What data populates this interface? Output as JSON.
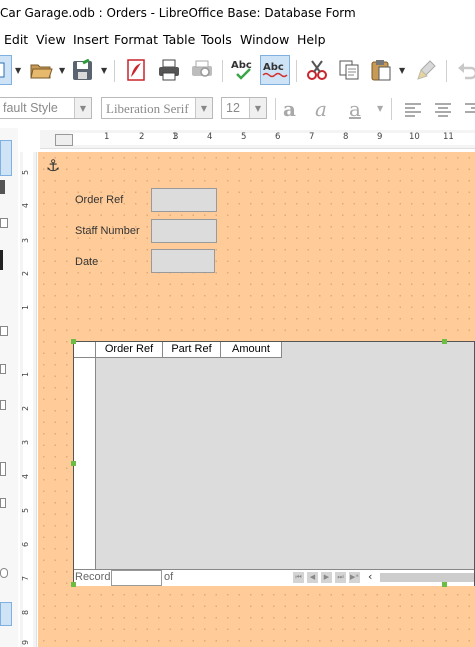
{
  "window": {
    "title": "Car Garage.odb : Orders - LibreOffice Base: Database Form"
  },
  "menu": [
    "Edit",
    "View",
    "Insert",
    "Format",
    "Table",
    "Tools",
    "Window",
    "Help"
  ],
  "toolbar": {
    "buttons": [
      "form-design-icon",
      "open-icon",
      "save-icon",
      "export-pdf-icon",
      "print-icon",
      "print-preview-icon",
      "spellcheck-icon",
      "auto-spellcheck-icon",
      "cut-icon",
      "copy-icon",
      "paste-icon",
      "clone-formatting-icon",
      "undo-icon"
    ]
  },
  "format_toolbar": {
    "paragraph_style": "fault Style",
    "font_name": "Liberation Serif",
    "font_size": "12"
  },
  "ruler": {
    "h_marks": [
      "1",
      "1",
      "2",
      "3",
      "4",
      "5",
      "6",
      "7",
      "8",
      "9",
      "10",
      "11"
    ],
    "v_marks": [
      "5",
      "4",
      "3",
      "2",
      "1",
      "1",
      "2",
      "3",
      "4",
      "5",
      "6",
      "7",
      "8",
      "9"
    ]
  },
  "form": {
    "fields": [
      {
        "label": "Order Ref",
        "value": ""
      },
      {
        "label": "Staff Number",
        "value": ""
      },
      {
        "label": "Date",
        "value": ""
      }
    ],
    "grid": {
      "columns": [
        "Order Ref",
        "Part Ref",
        "Amount"
      ],
      "record_label": "Record",
      "record_value": "",
      "of_label": "of"
    }
  },
  "colors": {
    "page_bg": "#ffcc99",
    "handle": "#6cbd45"
  }
}
